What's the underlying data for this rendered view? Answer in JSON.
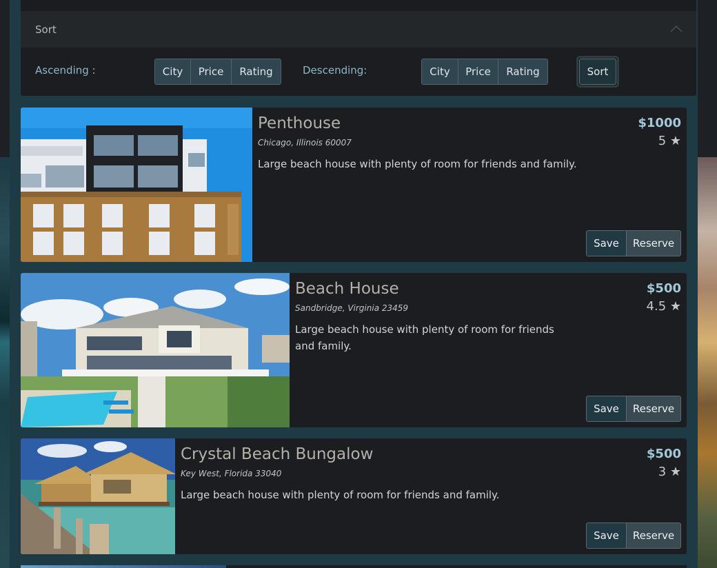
{
  "sort": {
    "header": "Sort",
    "ascending_label": "Ascending :",
    "descending_label": "Descending:",
    "ascending_buttons": [
      "City",
      "Price",
      "Rating"
    ],
    "descending_buttons": [
      "City",
      "Price",
      "Rating"
    ],
    "sort_button": "Sort"
  },
  "listings": [
    {
      "title": "Penthouse",
      "address": "Chicago, Illinois 60007",
      "description": "Large beach house with plenty of room for friends and family.",
      "price": "$1000",
      "rating": "5 ★",
      "save": "Save",
      "reserve": "Reserve"
    },
    {
      "title": "Beach House",
      "address": "Sandbridge, Virginia 23459",
      "description": "Large beach house with plenty of room for friends and family.",
      "price": "$500",
      "rating": "4.5 ★",
      "save": "Save",
      "reserve": "Reserve"
    },
    {
      "title": "Crystal Beach Bungalow",
      "address": "Key West, Florida 33040",
      "description": "Large beach house with plenty of room for friends and family.",
      "price": "$500",
      "rating": "3 ★",
      "save": "Save",
      "reserve": "Reserve"
    }
  ],
  "colors": {
    "accent": "#a3c9d8",
    "panel": "#1b1d20",
    "frame": "#1e3a44"
  }
}
